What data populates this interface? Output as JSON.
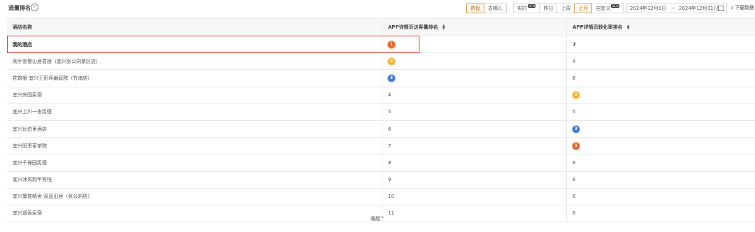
{
  "header": {
    "title": "流量排名",
    "help_icon": "?"
  },
  "channel_tabs": [
    {
      "label": "携程",
      "active": true
    },
    {
      "label": "去哪儿",
      "active": false
    }
  ],
  "period_tabs": [
    {
      "label": "实时",
      "badge": "NEW",
      "active": false
    },
    {
      "label": "昨日",
      "badge": "",
      "active": false
    },
    {
      "label": "上周",
      "badge": "",
      "active": false
    },
    {
      "label": "上月",
      "badge": "",
      "active": true
    },
    {
      "label": "自定义",
      "badge": "NEW",
      "active": false
    }
  ],
  "date_range": {
    "start": "2024年12月1日",
    "separator": "→",
    "end": "2024年12月31日"
  },
  "download_label": "下载数据",
  "table": {
    "columns": [
      "酒店名称",
      "APP详情页访客量排名",
      "APP详情页转化率排名"
    ],
    "rows": [
      {
        "name": "我的酒店",
        "visitor_rank": "1",
        "conversion_rank": "7",
        "highlight": true
      },
      {
        "name": "阅手宣春山居君宿（宜兴张公洞景区店）",
        "visitor_rank": "2",
        "conversion_rank": "4"
      },
      {
        "name": "花筑奢·宜兴王阳坪幽庭院（竹海店）",
        "visitor_rank": "3",
        "conversion_rank": "6"
      },
      {
        "name": "宜兴庆园民宿",
        "visitor_rank": "4",
        "conversion_rank": "2"
      },
      {
        "name": "宜兴上川一舍民宿",
        "visitor_rank": "5",
        "conversion_rank": "5"
      },
      {
        "name": "宜兴比伯里酒店",
        "visitor_rank": "6",
        "conversion_rank": "3"
      },
      {
        "name": "宜兴阳羡茗茶院",
        "visitor_rank": "7",
        "conversion_rank": "1"
      },
      {
        "name": "宜兴千禅园民宿",
        "visitor_rank": "8",
        "conversion_rank": "8"
      },
      {
        "name": "宜兴沐风韵年客栈",
        "visitor_rank": "9",
        "conversion_rank": "8"
      },
      {
        "name": "宜兴蔓提精舍·深蓝山居（张公洞店）",
        "visitor_rank": "10",
        "conversion_rank": "8"
      },
      {
        "name": "宜兴道香民宿",
        "visitor_rank": "11",
        "conversion_rank": "8"
      }
    ]
  },
  "collapse_label": "收起^",
  "colors": {
    "accent": "#d6a15a",
    "highlight_border": "#e53935",
    "gold": "#e8622c",
    "silver": "#f3b23a",
    "bronze": "#3a78d8"
  }
}
